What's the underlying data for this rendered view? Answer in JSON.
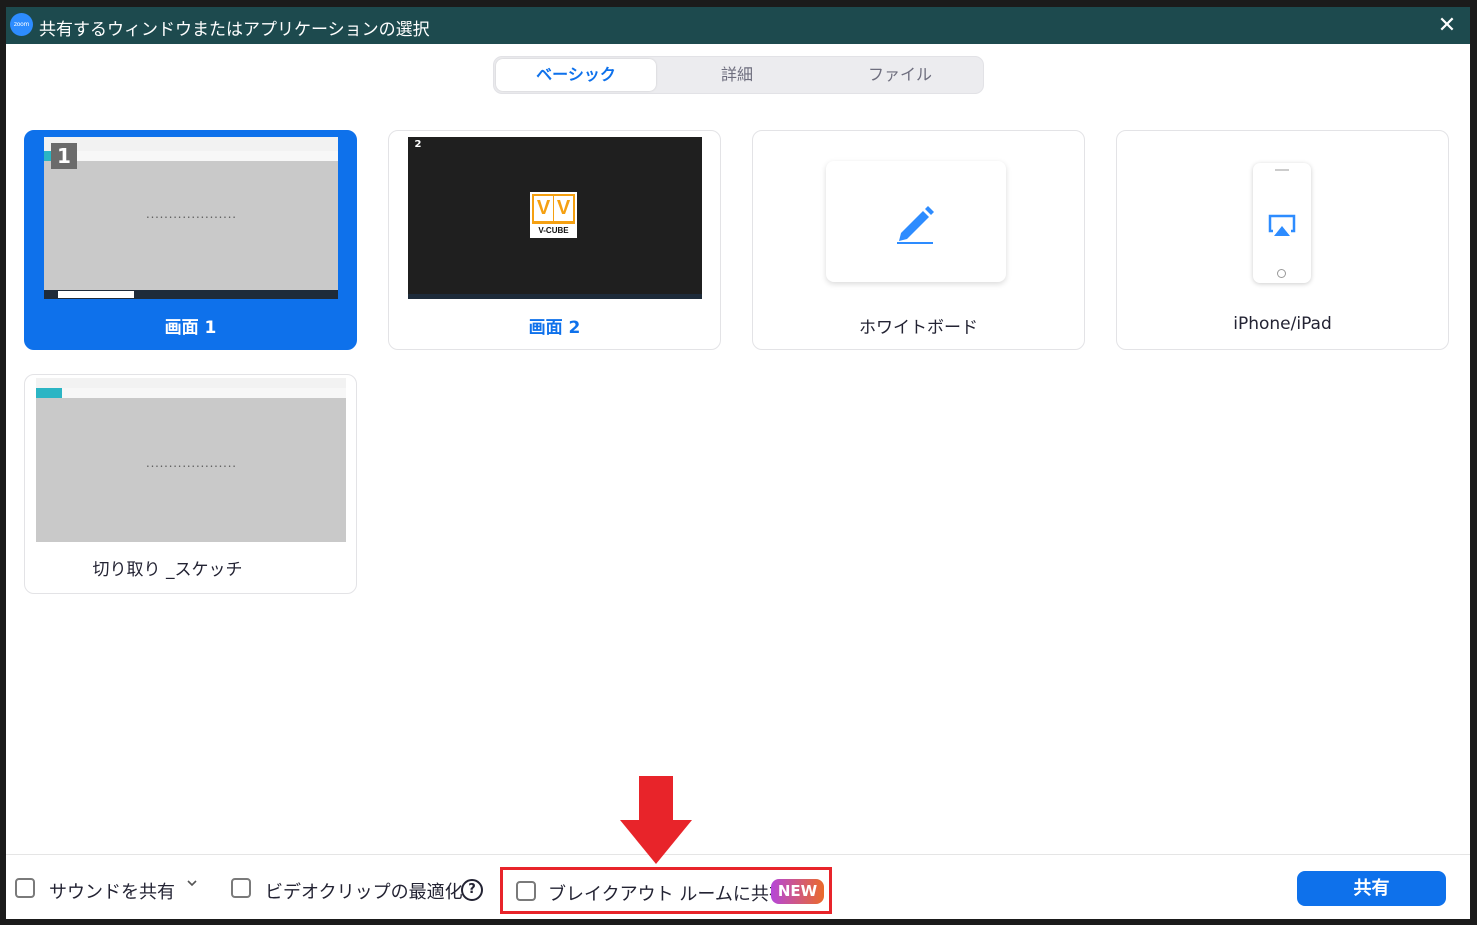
{
  "window": {
    "title": "共有するウィンドウまたはアプリケーションの選択",
    "logo_text": "zoom",
    "close_glyph": "✕"
  },
  "tabs": [
    {
      "label": "ベーシック",
      "active": true
    },
    {
      "label": "詳細",
      "active": false
    },
    {
      "label": "ファイル",
      "active": false
    }
  ],
  "tiles": [
    {
      "label": "画面 1",
      "selected": true,
      "badge": "1"
    },
    {
      "label": "画面 2",
      "selected": false,
      "badge": "2",
      "logo_text": "V-CUBE"
    },
    {
      "label": "ホワイトボード",
      "icon": "pencil-icon"
    },
    {
      "label": "iPhone/iPad",
      "icon": "airplay-icon"
    },
    {
      "label": "切り取り _スケッチ",
      "selected": false
    }
  ],
  "bottom": {
    "share_sound_label": "サウンドを共有",
    "optimize_video_label": "ビデオクリップの最適化",
    "help_glyph": "?",
    "breakout_label": "ブレイクアウト ルームに共有",
    "new_badge": "NEW",
    "share_button": "共有"
  },
  "colors": {
    "titlebar": "#1d4a4e",
    "accent": "#0e71eb",
    "highlight": "#e8242a"
  }
}
